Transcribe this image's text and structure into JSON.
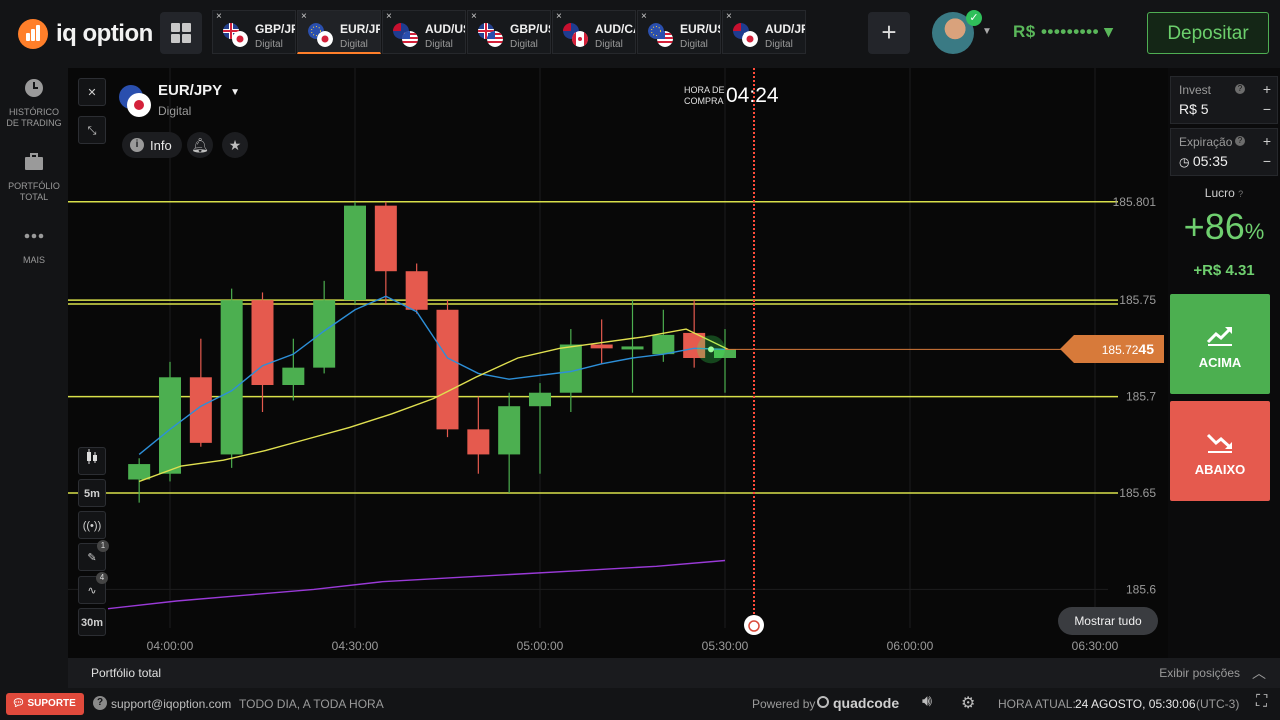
{
  "header": {
    "logo_text": "iq option",
    "brand_color": "#ff7f2a",
    "tabs": [
      {
        "pair": "GBP/JPY",
        "kind": "Digital",
        "flags": [
          "gb",
          "jp"
        ],
        "active": false
      },
      {
        "pair": "EUR/JPY",
        "kind": "Digital",
        "flags": [
          "eu",
          "jp"
        ],
        "active": true
      },
      {
        "pair": "AUD/USD",
        "kind": "Digital",
        "flags": [
          "au",
          "us"
        ],
        "active": false
      },
      {
        "pair": "GBP/USD",
        "kind": "Digital",
        "flags": [
          "gb",
          "us"
        ],
        "active": false
      },
      {
        "pair": "AUD/CAD",
        "kind": "Digital",
        "flags": [
          "au",
          "ca"
        ],
        "active": false
      },
      {
        "pair": "EUR/USD",
        "kind": "Digital",
        "flags": [
          "eu",
          "us"
        ],
        "active": false
      },
      {
        "pair": "AUD/JPY",
        "kind": "Digital",
        "flags": [
          "au",
          "jp"
        ],
        "active": false
      }
    ],
    "tab_close": "×",
    "add_tab": "+",
    "balance": "R$ ••••••••• ▾",
    "deposit_label": "Depositar"
  },
  "sidebar": {
    "items": [
      {
        "label_line1": "HISTÓRICO",
        "label_line2": "DE TRADING",
        "icon": "clock-icon"
      },
      {
        "label_line1": "PORTFÓLIO",
        "label_line2": "TOTAL",
        "icon": "briefcase-icon"
      },
      {
        "label_line1": "MAIS",
        "label_line2": "",
        "icon": "more-dots-icon"
      }
    ]
  },
  "asset": {
    "name": "EUR/JPY",
    "kind": "Digital",
    "info_label": "Info"
  },
  "purchase": {
    "label_line1": "HORA DE",
    "label_line2": "COMPRA",
    "timer": "04:24"
  },
  "price_tag": {
    "main": "185.72",
    "last": "45"
  },
  "tools": {
    "timeframe": "5m",
    "period": "30m",
    "badge_draw": "1",
    "badge_indicators": "4"
  },
  "show_all_label": "Mostrar tudo",
  "chart_data": {
    "type": "candlestick",
    "x_ticks": [
      "04:00:00",
      "04:30:00",
      "05:00:00",
      "05:30:00",
      "06:00:00",
      "06:30:00"
    ],
    "y_ticks": [
      "185.801",
      "185.75",
      "185.7",
      "185.65",
      "185.6"
    ],
    "ylim": [
      185.58,
      185.86
    ],
    "horizontal_levels": [
      185.801,
      185.75,
      185.748,
      185.7,
      185.65
    ],
    "current_price": 185.7245,
    "candle_times": [
      "03:55",
      "04:00",
      "04:05",
      "04:10",
      "04:15",
      "04:20",
      "04:25",
      "04:30",
      "04:35",
      "04:40",
      "04:45",
      "04:50",
      "04:55",
      "05:00",
      "05:05",
      "05:10",
      "05:15",
      "05:20",
      "05:25",
      "05:30"
    ],
    "candles": [
      {
        "o": 185.657,
        "h": 185.668,
        "c": 185.665,
        "l": 185.645
      },
      {
        "o": 185.66,
        "h": 185.718,
        "c": 185.71,
        "l": 185.656
      },
      {
        "o": 185.71,
        "h": 185.73,
        "c": 185.676,
        "l": 185.674
      },
      {
        "o": 185.67,
        "h": 185.756,
        "c": 185.75,
        "l": 185.663
      },
      {
        "o": 185.75,
        "h": 185.754,
        "c": 185.706,
        "l": 185.692
      },
      {
        "o": 185.706,
        "h": 185.73,
        "c": 185.715,
        "l": 185.698
      },
      {
        "o": 185.715,
        "h": 185.76,
        "c": 185.75,
        "l": 185.712
      },
      {
        "o": 185.75,
        "h": 185.801,
        "c": 185.799,
        "l": 185.748
      },
      {
        "o": 185.799,
        "h": 185.801,
        "c": 185.765,
        "l": 185.748
      },
      {
        "o": 185.765,
        "h": 185.769,
        "c": 185.745,
        "l": 185.743
      },
      {
        "o": 185.745,
        "h": 185.75,
        "c": 185.683,
        "l": 185.679
      },
      {
        "o": 185.683,
        "h": 185.7,
        "c": 185.67,
        "l": 185.66
      },
      {
        "o": 185.67,
        "h": 185.702,
        "c": 185.695,
        "l": 185.65
      },
      {
        "o": 185.695,
        "h": 185.707,
        "c": 185.702,
        "l": 185.66
      },
      {
        "o": 185.702,
        "h": 185.735,
        "c": 185.727,
        "l": 185.692
      },
      {
        "o": 185.727,
        "h": 185.74,
        "c": 185.725,
        "l": 185.717
      },
      {
        "o": 185.725,
        "h": 185.75,
        "c": 185.726,
        "l": 185.702
      },
      {
        "o": 185.722,
        "h": 185.745,
        "c": 185.732,
        "l": 185.718
      },
      {
        "o": 185.733,
        "h": 185.75,
        "c": 185.72,
        "l": 185.715
      },
      {
        "o": 185.72,
        "h": 185.735,
        "c": 185.7245,
        "l": 185.702
      }
    ],
    "series": [
      {
        "values": [
          185.67,
          185.683,
          185.695,
          185.703,
          185.716,
          185.722,
          185.734,
          185.745,
          185.752,
          185.744,
          185.72,
          185.712,
          185.709,
          185.711,
          185.713,
          185.717,
          185.72,
          185.722,
          185.725,
          185.7245
        ],
        "color": "#2d8fd8"
      },
      {
        "values": [
          185.656,
          185.664,
          185.667,
          185.672,
          185.678,
          185.684,
          185.691,
          185.699,
          185.71,
          185.72,
          185.725,
          185.728,
          185.731,
          185.735,
          185.7245
        ],
        "color": "#e0e050"
      },
      {
        "values": [
          185.59,
          185.594,
          185.597,
          185.6,
          185.604,
          185.606,
          185.608,
          185.61,
          185.612,
          185.615
        ],
        "color": "#9a3ad8"
      }
    ]
  },
  "trade": {
    "invest_label": "Invest",
    "invest_value": "R$ 5",
    "expiry_label": "Expiração",
    "expiry_value": "05:35",
    "profit_label": "Lucro",
    "profit_pct": "+86",
    "pct_sign": "%",
    "profit_value": "+R$ 4.31",
    "up_label": "ACIMA",
    "down_label": "ABAIXO",
    "plus": "+",
    "minus": "−",
    "up_color": "#4caf50",
    "down_color": "#e55a4e"
  },
  "portfolio_bar": {
    "title": "Portfólio total",
    "positions_label": "Exibir posições"
  },
  "footer": {
    "support_label": "SUPORTE",
    "email": "support@iqoption.com",
    "hours": "TODO DIA, A TODA HORA",
    "powered_by": "Powered by",
    "provider": "quadcode",
    "time_label": "HORA ATUAL:",
    "time_value": "24 AGOSTO, 05:30:06",
    "timezone": "(UTC-3)"
  }
}
